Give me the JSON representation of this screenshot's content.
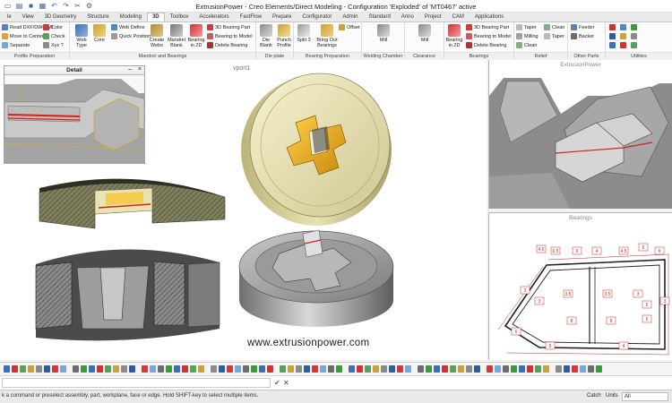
{
  "window": {
    "title": "ExtrusionPower - Creo Elements/Direct Modeling - Configuration 'Exploded' of 'MT0467' active"
  },
  "tabs": [
    "le",
    "View",
    "3D Geometry",
    "Structure",
    "Modeling",
    "3D",
    "Toolbox",
    "Accelerators",
    "FastFlow",
    "Prepare",
    "Configurator",
    "Admin",
    "Standard",
    "Anno",
    "Project",
    "CAM",
    "Applications"
  ],
  "active_tab_index": 5,
  "ribbon": {
    "profile_prep": {
      "label": "Profile Preparation",
      "items": [
        "Read DXF/DWG/MI",
        "Move to Center",
        "Separate"
      ],
      "items2": [
        "Color",
        "Check",
        "Xyz ?"
      ]
    },
    "mandrel_bearings": {
      "label": "Mandrel and Bearings",
      "web_type": "Web Type",
      "core": "Core",
      "web_define": "Web Define",
      "quick_position": "Quick Position",
      "create_webs": "Create Webs",
      "mandrel_blank": "Mandrel Blank",
      "bearing_2d": "Bearing in 2D",
      "bearing_part": "3D Bearing Part",
      "bearing_model": "Bearing to Model",
      "delete_bearing": "Delete Bearing"
    },
    "die_plate": {
      "label": "Die plate",
      "die_blank": "Die Blank",
      "punch_profile": "Punch Profile"
    },
    "bearing_prep": {
      "label": "Bearing Preparation",
      "split": "Split 3",
      "bring_out": "Bring Out Bearings",
      "offset": "Offset"
    },
    "welding": {
      "label": "Welding Chamber",
      "mill": "Mill"
    },
    "clearance": {
      "label": "Clearance Pocket",
      "mill": "Mill"
    },
    "bearings": {
      "label": "Bearings",
      "bearing_2d": "Bearing in 2D",
      "bearing_part": "3D Bearing Part",
      "bearing_model": "Bearing to Model",
      "delete_bearing": "Delete Bearing"
    },
    "relief": {
      "label": "Relief",
      "taper": "Taper",
      "milling": "Milling",
      "clean": "Clean",
      "clean2": "Clean",
      "taper2": "Taper"
    },
    "other_parts": {
      "label": "Other Parts",
      "feeder": "Feeder",
      "backer": "Backer"
    },
    "utilities": {
      "label": "Utilities"
    }
  },
  "viewport": {
    "label": "vport1",
    "watermark": "www.extrusionpower.com"
  },
  "detail_panel": {
    "title": "Detail"
  },
  "right_panel_top": {
    "title": "ExtrusionPower"
  },
  "right_panel_bottom": {
    "title": "Bearings",
    "dims": [
      "4.5",
      "6.5",
      "6",
      "4",
      "4.5",
      "6",
      "6",
      "3",
      "3",
      "3.5",
      "3.5",
      "3",
      "6",
      "3",
      "8",
      "8",
      "6",
      "6",
      "6",
      "4"
    ]
  },
  "status": {
    "message": "k a command or preselect assembly, part, workplane, face or edge. Hold SHIFT-key to select multiple items.",
    "catch": "Catch",
    "units": "Units",
    "select_value": "All"
  }
}
